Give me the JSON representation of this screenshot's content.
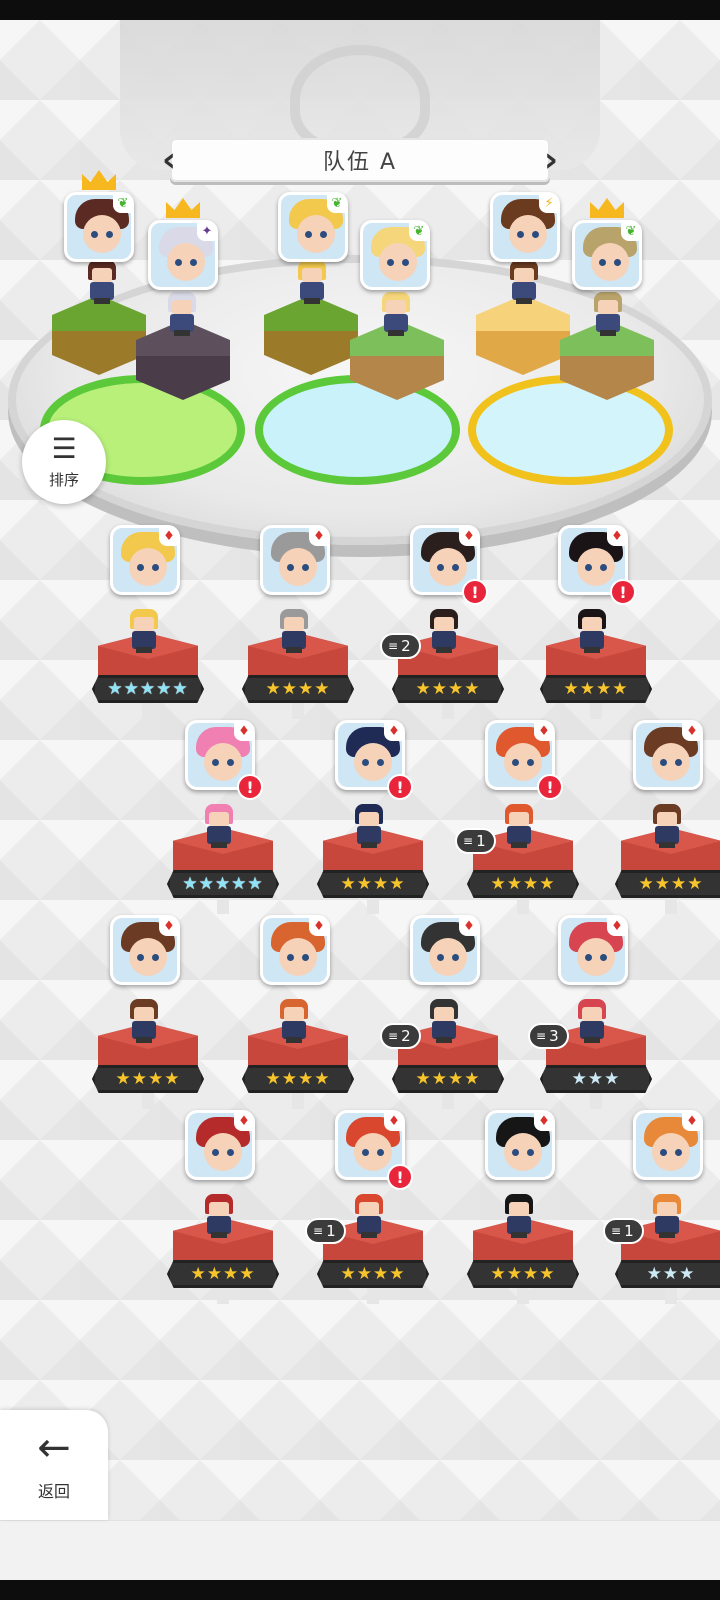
{
  "header": {
    "team_title": "队伍 A",
    "prev_icon": "chevron-left-icon",
    "next_icon": "chevron-right-icon"
  },
  "buttons": {
    "sort_label": "排序",
    "sort_icon": "sort-icon",
    "back_label": "返回",
    "back_icon": "arrow-left-icon"
  },
  "team": [
    {
      "pos": "left-back",
      "crown": true,
      "element": "leaf",
      "hair": "#5b2a22",
      "block": "grass"
    },
    {
      "pos": "left-front",
      "crown": true,
      "element": "dark",
      "hair": "#d9d9e8",
      "block": "stone"
    },
    {
      "pos": "mid-back",
      "crown": false,
      "element": "leaf",
      "hair": "#f2c94c",
      "block": "grass"
    },
    {
      "pos": "mid-front",
      "crown": false,
      "element": "leaf",
      "hair": "#f5d67a",
      "block": "grass2"
    },
    {
      "pos": "right-back",
      "crown": false,
      "element": "bolt",
      "hair": "#6b3b1f",
      "block": "sand"
    },
    {
      "pos": "right-front",
      "crown": true,
      "element": "leaf",
      "hair": "#b8a36b",
      "block": "grass2"
    }
  ],
  "roster": [
    {
      "hair": "#f2c94c",
      "stars": "★★★★★",
      "star_type": "rainbow",
      "alert": false,
      "copies": ""
    },
    {
      "hair": "#9a9a9a",
      "stars": "★★★★",
      "star_type": "gold",
      "alert": false,
      "copies": ""
    },
    {
      "hair": "#2a1f1c",
      "stars": "★★★★",
      "star_type": "gold",
      "alert": true,
      "alert_text": "!",
      "copies": "2"
    },
    {
      "hair": "#1b1416",
      "stars": "★★★★",
      "star_type": "gold",
      "alert": true,
      "alert_text": "!",
      "copies": ""
    },
    {
      "hair": "#f07fb2",
      "stars": "★★★★★",
      "star_type": "rainbow",
      "alert": true,
      "alert_text": "!",
      "copies": ""
    },
    {
      "hair": "#1f2a55",
      "stars": "★★★★",
      "star_type": "gold",
      "alert": true,
      "alert_text": "!",
      "copies": ""
    },
    {
      "hair": "#e0582e",
      "stars": "★★★★",
      "star_type": "gold",
      "alert": true,
      "alert_text": "!",
      "copies": "1"
    },
    {
      "hair": "#6b3b24",
      "stars": "★★★★",
      "star_type": "gold",
      "alert": false,
      "copies": ""
    },
    {
      "hair": "#6b3b24",
      "stars": "★★★★",
      "star_type": "gold",
      "alert": false,
      "copies": ""
    },
    {
      "hair": "#d8642f",
      "stars": "★★★★",
      "star_type": "gold",
      "alert": false,
      "copies": ""
    },
    {
      "hair": "#333333",
      "stars": "★★★★",
      "star_type": "gold",
      "alert": false,
      "copies": "2"
    },
    {
      "hair": "#d64550",
      "stars": "★★★",
      "star_type": "silver",
      "alert": false,
      "copies": "3"
    },
    {
      "hair": "#b52a2a",
      "stars": "★★★★",
      "star_type": "gold",
      "alert": false,
      "copies": ""
    },
    {
      "hair": "#d9472f",
      "stars": "★★★★",
      "star_type": "gold",
      "alert": true,
      "alert_text": "!",
      "copies": "1"
    },
    {
      "hair": "#161616",
      "stars": "★★★★",
      "star_type": "gold",
      "alert": false,
      "copies": ""
    },
    {
      "hair": "#e8893a",
      "stars": "★★★",
      "star_type": "silver",
      "alert": false,
      "copies": "1"
    }
  ],
  "colors": {
    "fire_element": "#d9312b",
    "leaf_element": "#45b42e",
    "bolt_element": "#f2b21b",
    "alert": "#e8253a",
    "crown": "#f6b81e",
    "pedestal": "#c7473d"
  }
}
